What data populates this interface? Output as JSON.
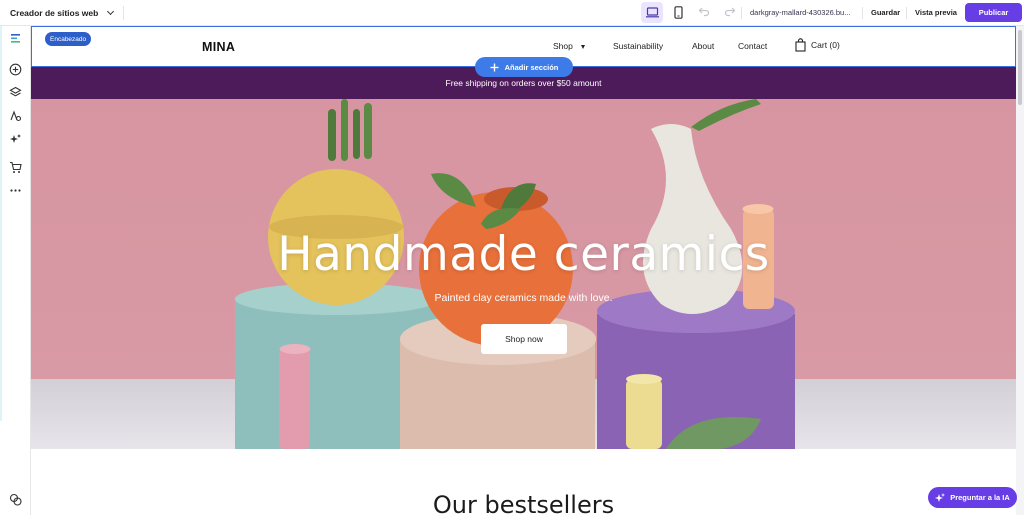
{
  "topbar": {
    "app_title": "Creador de sitios web",
    "domain": "darkgray-mallard-430326.bu...",
    "save_label": "Guardar",
    "preview_label": "Vista previa",
    "publish_label": "Publicar",
    "accent_color": "#673de6"
  },
  "left_toolbar": {
    "icons": [
      "add-circle-icon",
      "layers-icon",
      "typography-icon",
      "ai-sparkle-icon",
      "cart-icon",
      "more-icon",
      "help-icon"
    ]
  },
  "editor": {
    "header_tag": "Encabezado",
    "add_section_label": "Añadir sección"
  },
  "site": {
    "logo": "MINA",
    "nav": {
      "shop": "Shop",
      "sustainability": "Sustainability",
      "about": "About",
      "contact": "Contact",
      "cart": "Cart (0)"
    },
    "banner_text": "Free shipping on orders over $50 amount",
    "banner_color": "#4d1b5a",
    "hero": {
      "title": "Handmade ceramics",
      "subtitle": "Painted clay ceramics made with love.",
      "button": "Shop now"
    },
    "section_title": "Our bestsellers"
  },
  "ai_button": "Preguntar a la IA"
}
